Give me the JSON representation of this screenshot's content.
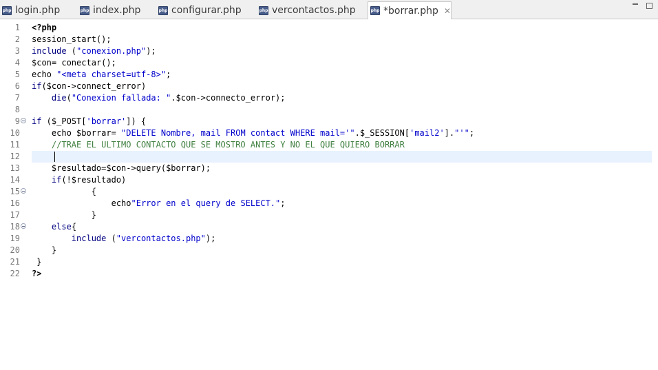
{
  "tabs": [
    {
      "label": "login.php",
      "icon": "php-file-icon",
      "active": false
    },
    {
      "label": "index.php",
      "icon": "php-file-icon",
      "active": false
    },
    {
      "label": "configurar.php",
      "icon": "php-file-icon",
      "active": false
    },
    {
      "label": "vercontactos.php",
      "icon": "php-file-icon",
      "active": false
    },
    {
      "label": "*borrar.php",
      "icon": "php-file-icon",
      "active": true
    }
  ],
  "icon_text": "php",
  "close_glyph": "✕",
  "editor": {
    "current_line": 12,
    "fold_markers": [
      9,
      15,
      18
    ],
    "lines": [
      {
        "n": "1",
        "text": "<?php"
      },
      {
        "n": "2",
        "text": "session_start();"
      },
      {
        "n": "3",
        "text": "include (\"conexion.php\");"
      },
      {
        "n": "4",
        "text": "$con= conectar();"
      },
      {
        "n": "5",
        "text": "echo \"<meta charset=utf-8>\";"
      },
      {
        "n": "6",
        "text": "if($con->connect_error)"
      },
      {
        "n": "7",
        "text": "    die(\"Conexion fallada: \".$con->connecto_error);"
      },
      {
        "n": "8",
        "text": ""
      },
      {
        "n": "9",
        "text": "if ($_POST['borrar']) {"
      },
      {
        "n": "10",
        "text": "    echo $borrar= \"DELETE Nombre, mail FROM contact WHERE mail='\".$_SESSION['mail2'].\"'\";"
      },
      {
        "n": "11",
        "text": "    //TRAE EL ULTIMO CONTACTO QUE SE MOSTRO ANTES Y NO EL QUE QUIERO BORRAR"
      },
      {
        "n": "12",
        "text": ""
      },
      {
        "n": "13",
        "text": "    $resultado=$con->query($borrar);"
      },
      {
        "n": "14",
        "text": "    if(!$resultado)"
      },
      {
        "n": "15",
        "text": "            {"
      },
      {
        "n": "16",
        "text": "                echo\"Error en el query de SELECT.\";"
      },
      {
        "n": "17",
        "text": "            }"
      },
      {
        "n": "18",
        "text": "    else{"
      },
      {
        "n": "19",
        "text": "        include (\"vercontactos.php\");"
      },
      {
        "n": "20",
        "text": "    }"
      },
      {
        "n": "21",
        "text": " }"
      },
      {
        "n": "22",
        "text": "?>"
      }
    ]
  },
  "colors": {
    "keyword": "#000080",
    "string": "#0000cc",
    "comment": "#3f7f3f",
    "current_line_bg": "#e8f2fe"
  }
}
